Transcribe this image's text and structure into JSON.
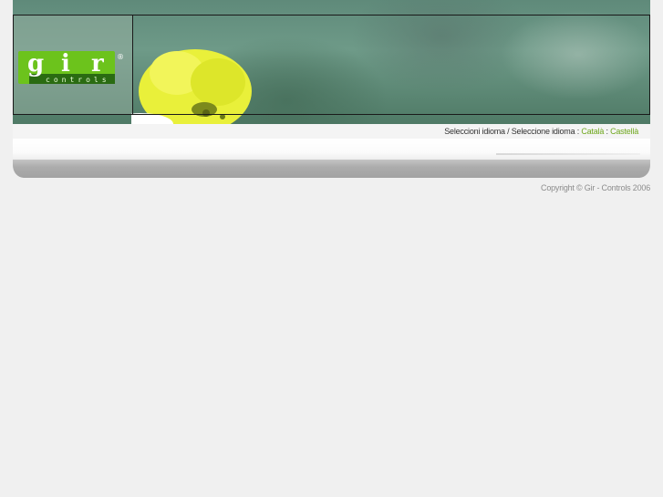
{
  "logo": {
    "letters": [
      "g",
      "i",
      "r"
    ],
    "subtitle": "controls",
    "registered": "®"
  },
  "language_bar": {
    "prompt": "Seleccioni idioma / Seleccione idioma :",
    "catalan": "Català",
    "separator": ":",
    "castilian": "Castellà"
  },
  "footer": {
    "copyright": "Copyright © Gir - Controls 2006"
  },
  "colors": {
    "accent_green": "#6fa71e",
    "logo_green": "#6cc31c",
    "band_gray": "#a8a8a8"
  }
}
